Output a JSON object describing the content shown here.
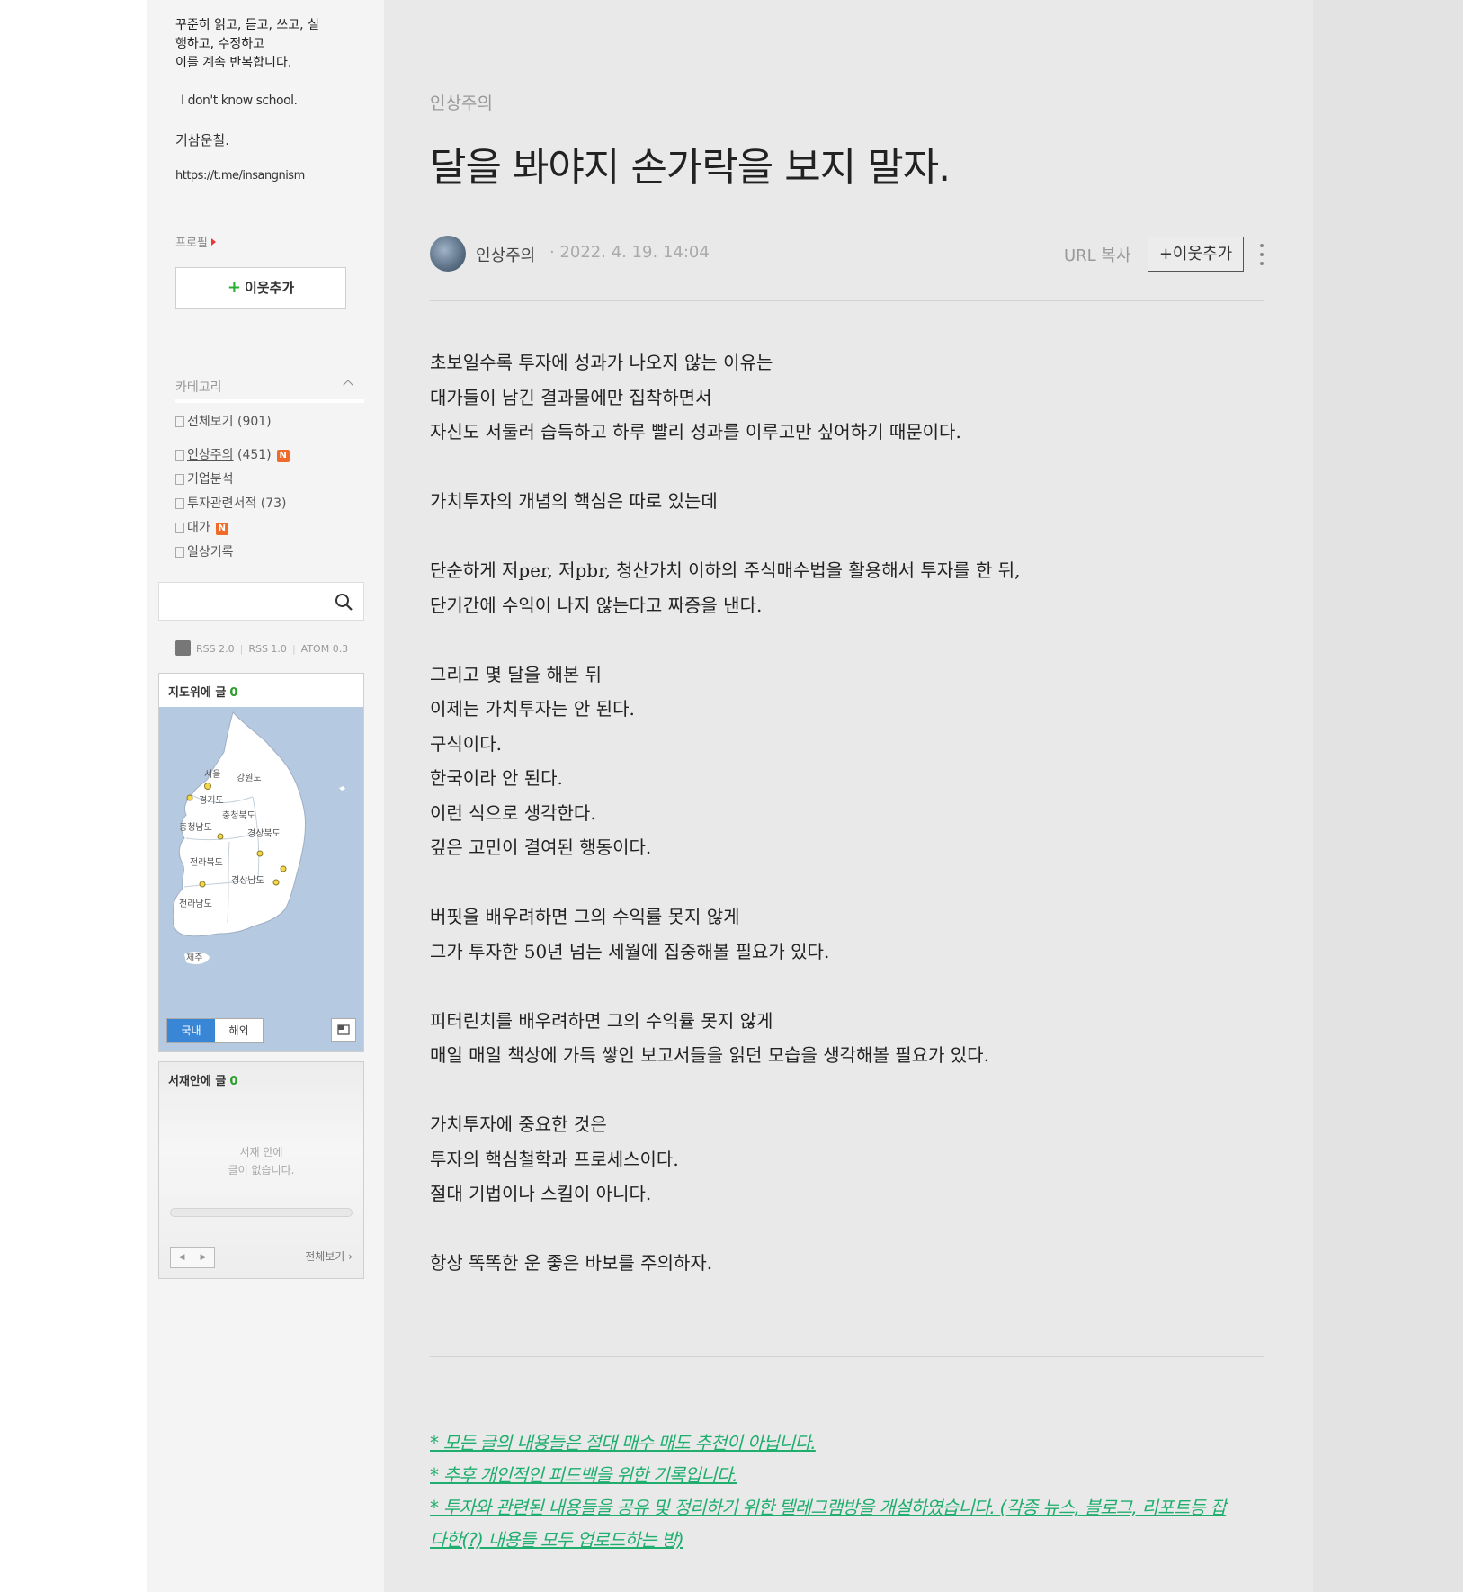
{
  "sidebar": {
    "intro_lines": [
      "꾸준히 읽고, 듣고, 쓰고, 실",
      "행하고, 수정하고",
      "이를 계속 반복합니다."
    ],
    "motto": "I don't know school.",
    "motto2": "기삼운칠.",
    "telegram_link": "https://t.me/insangnism",
    "profile_label": "프로필",
    "add_neighbor_label": "이웃추가",
    "category_header": "카테고리",
    "categories": [
      {
        "label": "전체보기",
        "count": "(901)",
        "new": false
      },
      {
        "label": "인상주의",
        "count": "(451)",
        "new": true
      },
      {
        "label": "기업분석",
        "count": "",
        "new": false
      },
      {
        "label": "투자관련서적",
        "count": "(73)",
        "new": false
      },
      {
        "label": "대가",
        "count": "",
        "new": true
      },
      {
        "label": "일상기록",
        "count": "",
        "new": false
      }
    ],
    "new_badge": "N",
    "search_placeholder": "",
    "rss": [
      "RSS 2.0",
      "RSS 1.0",
      "ATOM 0.3"
    ],
    "map_widget": {
      "title": "지도위에 글",
      "count": "0",
      "regions": [
        "서울",
        "강원도",
        "경기도",
        "충청북도",
        "충청남도",
        "경상북도",
        "전라북도",
        "경상남도",
        "전라남도",
        "제주"
      ],
      "tab_domestic": "국내",
      "tab_overseas": "해외"
    },
    "shelf_widget": {
      "title": "서재안에 글",
      "count": "0",
      "empty_line1": "서재 안에",
      "empty_line2": "글이 없습니다.",
      "view_all": "전체보기"
    }
  },
  "post": {
    "category": "인상주의",
    "title": "달을 봐야지 손가락을 보지 말자.",
    "author": "인상주의",
    "date": "· 2022. 4. 19. 14:04",
    "url_copy": "URL 복사",
    "neighbor_button": "+이웃추가",
    "body_lines": [
      "초보일수록 투자에 성과가 나오지 않는 이유는",
      "대가들이 남긴 결과물에만 집착하면서",
      "자신도 서둘러 습득하고 하루 빨리 성과를 이루고만 싶어하기 때문이다.",
      "",
      "가치투자의 개념의 핵심은 따로 있는데",
      "",
      "단순하게 저per, 저pbr, 청산가치 이하의 주식매수법을 활용해서 투자를 한 뒤,",
      "단기간에 수익이 나지 않는다고 짜증을 낸다.",
      "",
      "그리고 몇 달을 해본 뒤",
      "이제는 가치투자는 안 된다.",
      "구식이다.",
      "한국이라 안 된다.",
      "이런 식으로 생각한다.",
      "깊은 고민이 결여된 행동이다.",
      "",
      "버핏을 배우려하면 그의 수익률 못지 않게",
      "그가 투자한 50년 넘는 세월에 집중해볼 필요가 있다.",
      "",
      "피터린치를 배우려하면 그의 수익률 못지 않게",
      "매일 매일 책상에 가득 쌓인 보고서들을 읽던 모습을 생각해볼 필요가 있다.",
      "",
      "가치투자에 중요한 것은",
      "투자의 핵심철학과 프로세스이다.",
      "절대 기법이나 스킬이 아니다.",
      "",
      "항상 똑똑한 운 좋은 바보를 주의하자."
    ],
    "notices": [
      "* 모든 글의 내용들은 절대 매수 매도 추천이 아닙니다.",
      "* 추후 개인적인 피드백을 위한 기록입니다.",
      "* 투자와 관련된 내용들을 공유 및 정리하기 위한 텔레그램방을 개설하였습니다. (각종 뉴스, 블로그, 리포트등 잡",
      "다한(?) 내용들 모두 업로드하는 방)"
    ]
  },
  "colors": {
    "notice_green": "#1fae6e",
    "new_badge": "#f06a2a",
    "map_tab_active": "#3a86d6",
    "count_green": "#2a9d2a"
  }
}
